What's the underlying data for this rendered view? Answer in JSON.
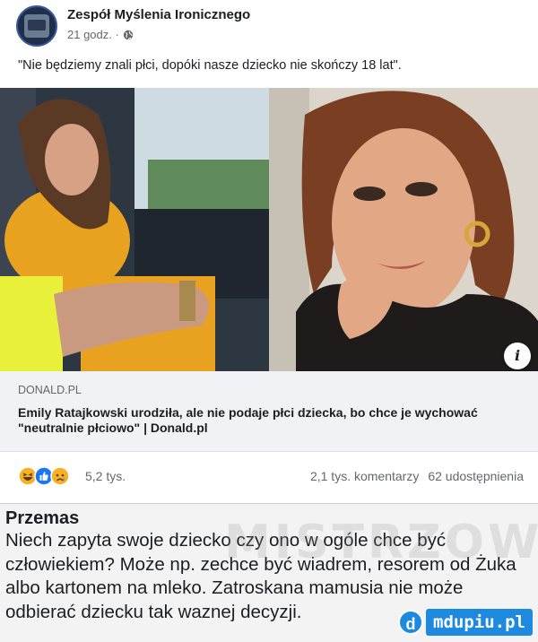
{
  "post": {
    "page_name": "Zespół Myślenia Ironicznego",
    "time": "21 godz. ·",
    "text": "\"Nie będziemy znali płci, dopóki nasze dziecko nie skończy 18 lat\"."
  },
  "link_preview": {
    "domain": "DONALD.PL",
    "title": "Emily Ratajkowski urodziła, ale nie podaje płci dziecka, bo chce je wychować \"neutralnie płciowo\" | Donald.pl",
    "info_glyph": "i"
  },
  "engagement": {
    "reactions": "5,2 tys.",
    "comments": "2,1 tys. komentarzy",
    "shares": "62 udostępnienia"
  },
  "comment": {
    "author": "Przemas",
    "text": "Niech zapyta swoje dziecko czy ono w ogóle chce być człowiekiem? Może np. zechce być wiadrem, resorem od Żuka albo kartonem na mleko. Zatroskana mamusia nie może odbierać dziecku tak waznej decyzji."
  },
  "watermark": {
    "text": "MISTRZOWIE.ORG",
    "badge_icon": "d",
    "badge_text": "mdupiu.pl"
  },
  "icons": [
    "page-avatar",
    "globe-icon",
    "info-icon",
    "haha-reaction-icon",
    "like-reaction-icon",
    "sad-reaction-icon"
  ],
  "colors": {
    "fb_gray_bg": "#f0f2f5",
    "like_blue": "#1877f2",
    "haha_yellow": "#f7b125",
    "badge_blue": "#1d8ae0"
  }
}
